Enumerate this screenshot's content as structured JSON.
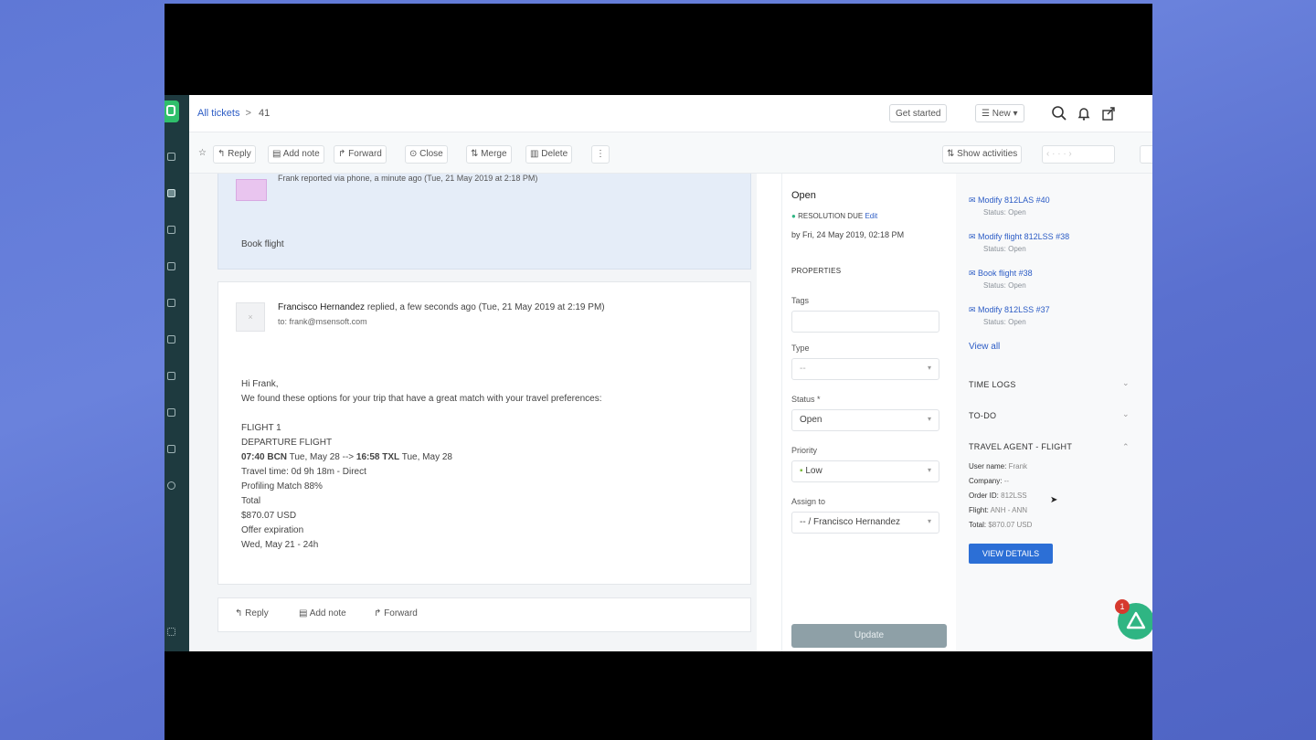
{
  "header": {
    "breadcrumb": "All tickets",
    "separator": ">",
    "ticket_number": "41",
    "get_started": "Get started",
    "new_label": "New"
  },
  "toolbar": {
    "reply": "Reply",
    "add_note": "Add note",
    "forward": "Forward",
    "close": "Close",
    "merge": "Merge",
    "delete": "Delete",
    "show_activities": "Show activities"
  },
  "conversation": {
    "first_note_meta": "Frank reported via phone, a minute ago (Tue, 21 May 2019 at 2:18 PM)",
    "first_note_body": "Book flight",
    "reply_author": "Francisco Hernandez",
    "reply_meta": "replied, a few seconds ago (Tue, 21 May 2019 at 2:19 PM)",
    "reply_to": "to: frank@msensoft.com",
    "body_lines": [
      "Hi Frank,",
      "We found these options for your trip that have a great match with your travel preferences:",
      "",
      "FLIGHT 1",
      "DEPARTURE FLIGHT",
      "",
      "Travel time: 0d 9h 18m - Direct",
      "Profiling Match 88%",
      "Total",
      "$870.07 USD",
      "Offer expiration",
      "Wed, May 21 - 24h"
    ],
    "flight_bold_1": "07:40 BCN",
    "flight_mid": " Tue, May 28 --> ",
    "flight_bold_2": "16:58 TXL",
    "flight_end": " Tue, May 28",
    "bottom_reply": "Reply",
    "bottom_add_note": "Add note",
    "bottom_forward": "Forward"
  },
  "properties": {
    "status_title": "Open",
    "resolution_label": "RESOLUTION DUE",
    "resolution_edit": "Edit",
    "resolution_by": "by Fri, 24 May 2019, 02:18 PM",
    "section_title": "PROPERTIES",
    "tags_label": "Tags",
    "type_label": "Type",
    "type_value": "--",
    "status_label": "Status *",
    "status_value": "Open",
    "priority_label": "Priority",
    "priority_value": "Low",
    "assign_label": "Assign to",
    "assign_value": "-- / Francisco Hernandez",
    "update_button": "Update",
    "priority_color": "#7dbb3f"
  },
  "related": {
    "items": [
      {
        "title": "Modify 812LAS #40",
        "status": "Status: Open"
      },
      {
        "title": "Modify flight 812LSS #38",
        "status": "Status: Open"
      },
      {
        "title": "Book flight #38",
        "status": "Status: Open"
      },
      {
        "title": "Modify 812LSS #37",
        "status": "Status: Open"
      }
    ],
    "view_all": "View all",
    "time_logs": "TIME LOGS",
    "todo": "TO-DO",
    "travel_agent": "TRAVEL AGENT - FLIGHT",
    "user_name_label": "User name:",
    "user_name_value": "Frank",
    "company_label": "Company:",
    "company_value": "--",
    "order_label": "Order ID:",
    "order_value": "812LSS",
    "flight_label": "Flight:",
    "flight_value": "ANH - ANN",
    "total_label": "Total:",
    "total_value": "$870.07 USD",
    "view_details": "VIEW DETAILS",
    "fab_badge": "1"
  }
}
